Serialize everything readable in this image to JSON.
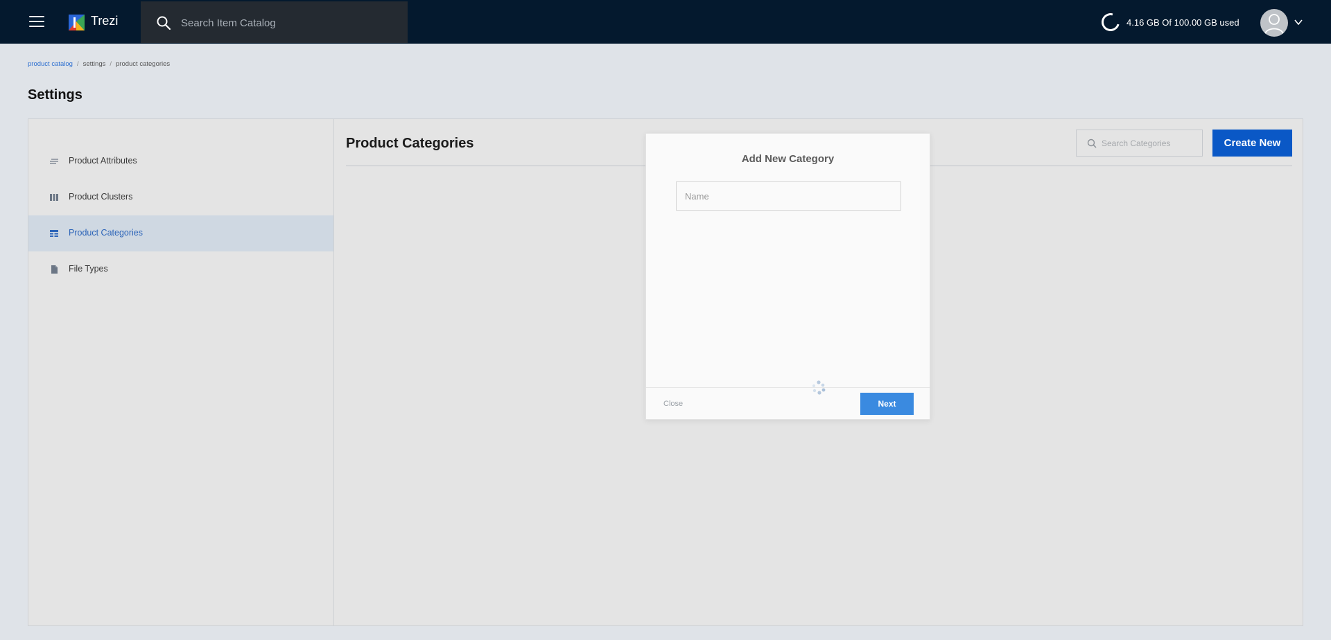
{
  "topbar": {
    "brand": "Trezi",
    "search_placeholder": "Search Item Catalog",
    "storage_text": "4.16 GB Of 100.00 GB used",
    "icons": [
      "menu-icon",
      "trezi-logo",
      "search-icon",
      "storage-ring-icon",
      "avatar-icon",
      "chevron-down-icon"
    ]
  },
  "breadcrumb": {
    "items": [
      "product catalog",
      "settings",
      "product categories"
    ],
    "separator": "/"
  },
  "page": {
    "title": "Settings"
  },
  "sidebar": {
    "items": [
      {
        "label": "Product Attributes",
        "icon": "attributes-icon",
        "active": false
      },
      {
        "label": "Product Clusters",
        "icon": "clusters-icon",
        "active": false
      },
      {
        "label": "Product Categories",
        "icon": "categories-icon",
        "active": true
      },
      {
        "label": "File Types",
        "icon": "file-icon",
        "active": false
      }
    ]
  },
  "content": {
    "title": "Product Categories",
    "search_placeholder": "Search Categories",
    "create_label": "Create New"
  },
  "modal": {
    "title": "Add New Category",
    "name_placeholder": "Name",
    "name_value": "",
    "close_label": "Close",
    "next_label": "Next"
  },
  "colors": {
    "topbar_bg": "#04192e",
    "accent": "#0a58c6",
    "active_item_bg": "#cfd8e2",
    "active_item_text": "#2c64b8",
    "next_button": "#3a8ae0"
  }
}
